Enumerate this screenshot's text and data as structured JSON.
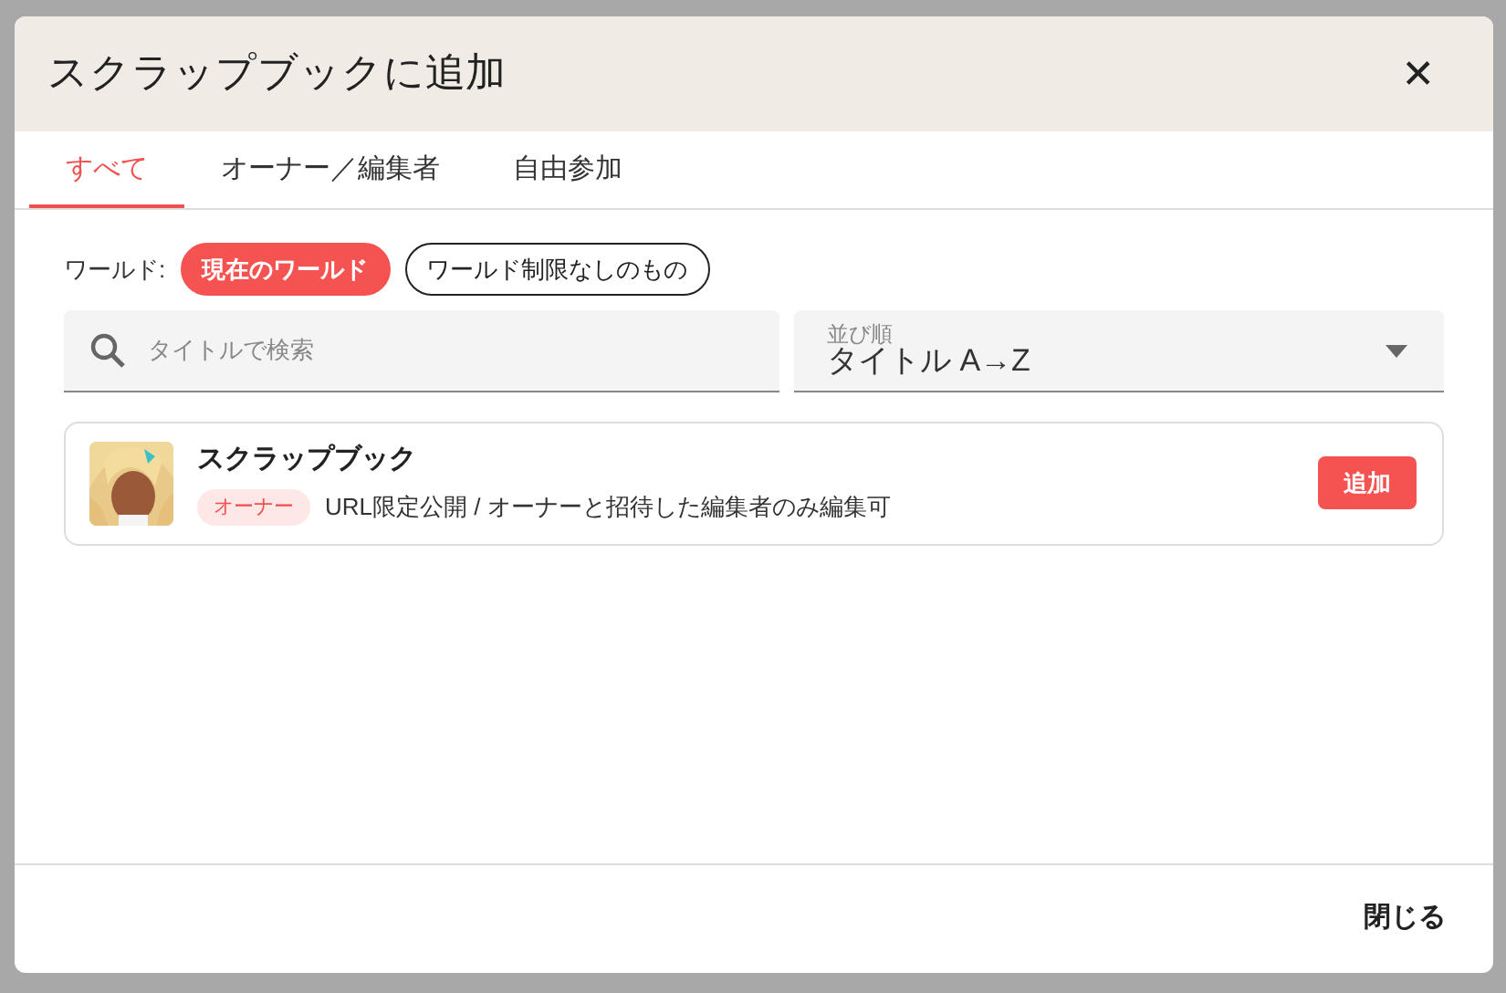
{
  "dialog": {
    "title": "スクラップブックに追加",
    "close_icon": "✕"
  },
  "tabs": [
    {
      "label": "すべて",
      "selected": true
    },
    {
      "label": "オーナー／編集者",
      "selected": false
    },
    {
      "label": "自由参加",
      "selected": false
    }
  ],
  "world_filter": {
    "label": "ワールド:",
    "options": [
      {
        "label": "現在のワールド",
        "selected": true
      },
      {
        "label": "ワールド制限なしのもの",
        "selected": false
      }
    ]
  },
  "search": {
    "placeholder": "タイトルで検索"
  },
  "sort": {
    "label": "並び順",
    "value": "タイトル A→Z"
  },
  "scrapbooks": [
    {
      "title": "スクラップブック",
      "role": "オーナー",
      "description": "URL限定公開 / オーナーと招待した編集者のみ編集可",
      "button": "追加"
    }
  ],
  "footer": {
    "button": "閉じる"
  }
}
